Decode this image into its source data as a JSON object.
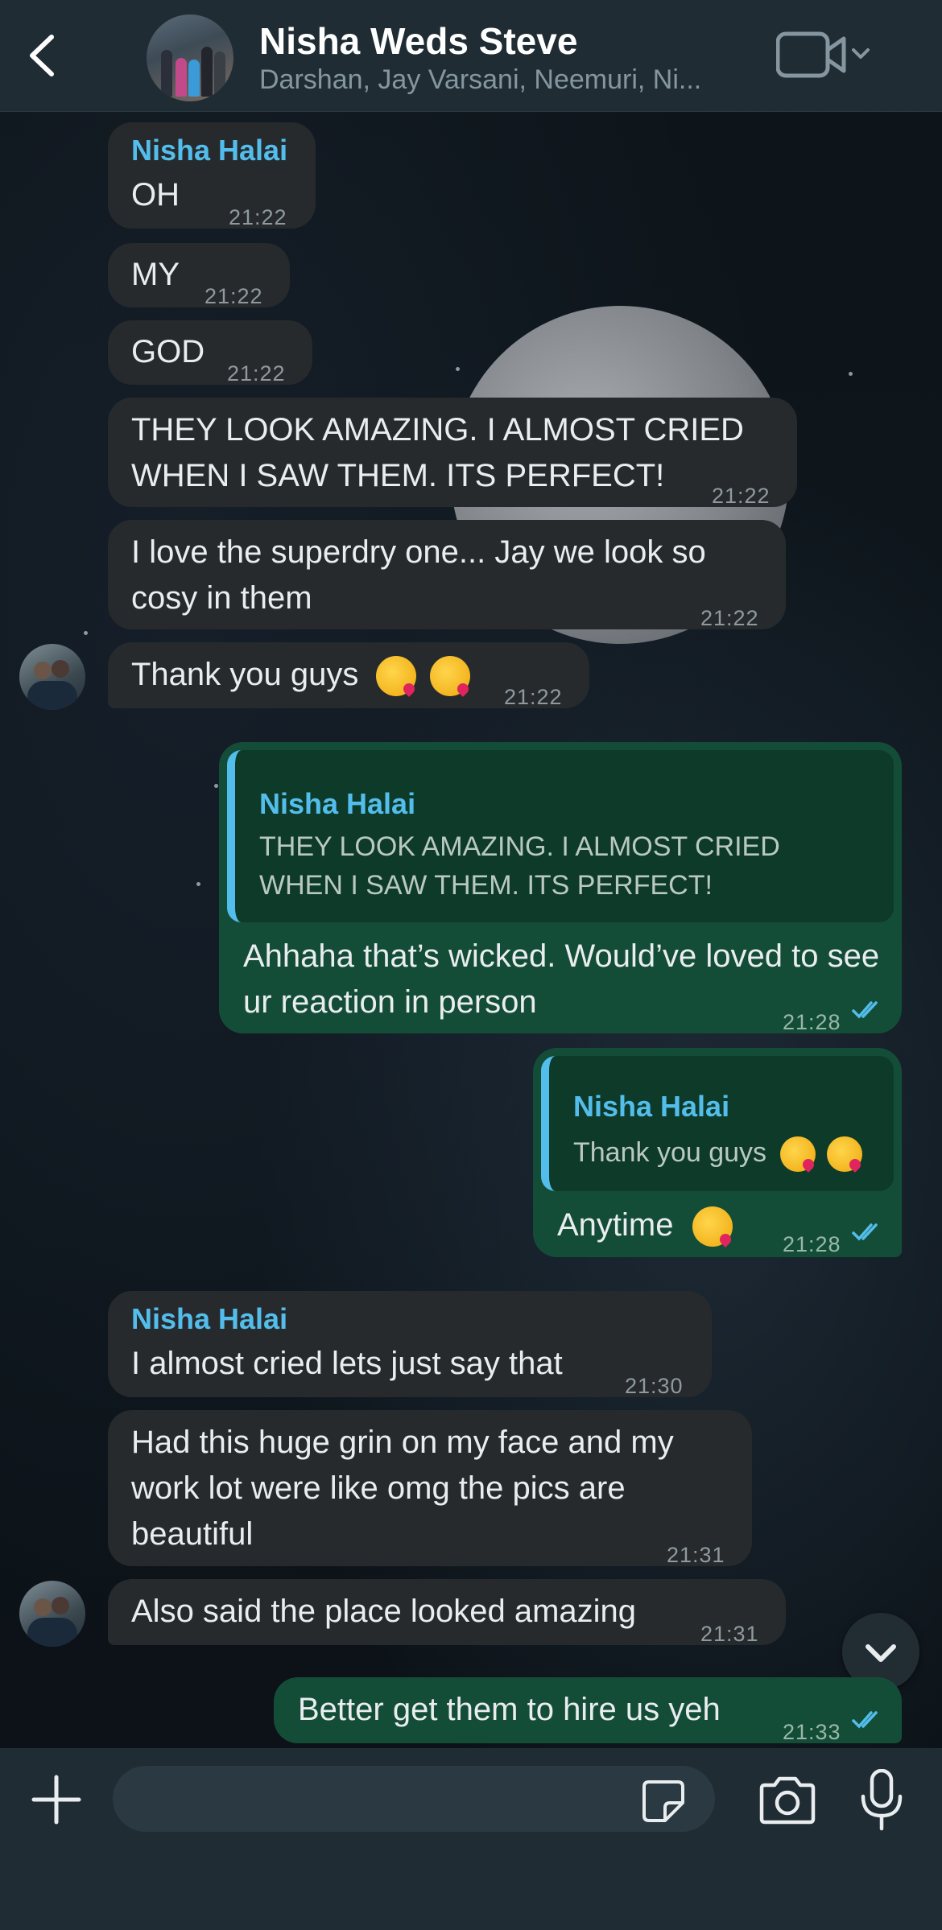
{
  "header": {
    "back_icon": "chevron-left-icon",
    "title": "Nisha Weds Steve",
    "subtitle": "Darshan, Jay Varsani, Neemuri, Ni...",
    "video_icon": "video-camera-icon",
    "dropdown_icon": "chevron-down-icon"
  },
  "messages": [
    {
      "direction": "in",
      "sender": "Nisha Halai",
      "text": "OH",
      "time": "21:22"
    },
    {
      "direction": "in",
      "text": "MY",
      "time": "21:22"
    },
    {
      "direction": "in",
      "text": "GOD",
      "time": "21:22"
    },
    {
      "direction": "in",
      "text": "THEY LOOK AMAZING. I ALMOST CRIED WHEN I SAW THEM. ITS PERFECT!",
      "time": "21:22"
    },
    {
      "direction": "in",
      "text": "I love the superdry one... Jay we look so cosy in them",
      "time": "21:22"
    },
    {
      "direction": "in",
      "text": "Thank you guys",
      "emoji": "kissing-face-with-heart-emoji x2",
      "time": "21:22"
    },
    {
      "direction": "out",
      "quote": {
        "sender": "Nisha Halai",
        "text": "THEY LOOK AMAZING. I ALMOST CRIED WHEN I SAW THEM. ITS PERFECT!"
      },
      "text": "Ahhaha that’s wicked. Would’ve loved to see ur reaction in person",
      "time": "21:28",
      "status": "read"
    },
    {
      "direction": "out",
      "quote": {
        "sender": "Nisha Halai",
        "text": "Thank you guys"
      },
      "text": "Anytime",
      "emoji": "smiling-face-with-hearts-emoji",
      "time": "21:28",
      "status": "read"
    },
    {
      "direction": "in",
      "sender": "Nisha Halai",
      "text": "I almost cried lets just say that",
      "time": "21:30"
    },
    {
      "direction": "in",
      "text": "Had this huge grin on my face and my work lot were like omg the pics are beautiful",
      "time": "21:31"
    },
    {
      "direction": "in",
      "text": "Also said the place looked amazing",
      "time": "21:31"
    },
    {
      "direction": "out",
      "text": "Better get them to hire us yeh",
      "time": "21:33",
      "status": "read"
    }
  ],
  "composer": {
    "placeholder": "",
    "plus_icon": "plus-icon",
    "sticker_icon": "sticker-icon",
    "camera_icon": "camera-icon",
    "mic_icon": "microphone-icon"
  },
  "scroll_down_icon": "chevron-down-icon",
  "colors": {
    "header_bg": "#1f2c33",
    "incoming_bubble": "#262a2d",
    "outgoing_bubble": "#144d37",
    "sender_name": "#53bdeb",
    "read_tick": "#53bdeb"
  }
}
